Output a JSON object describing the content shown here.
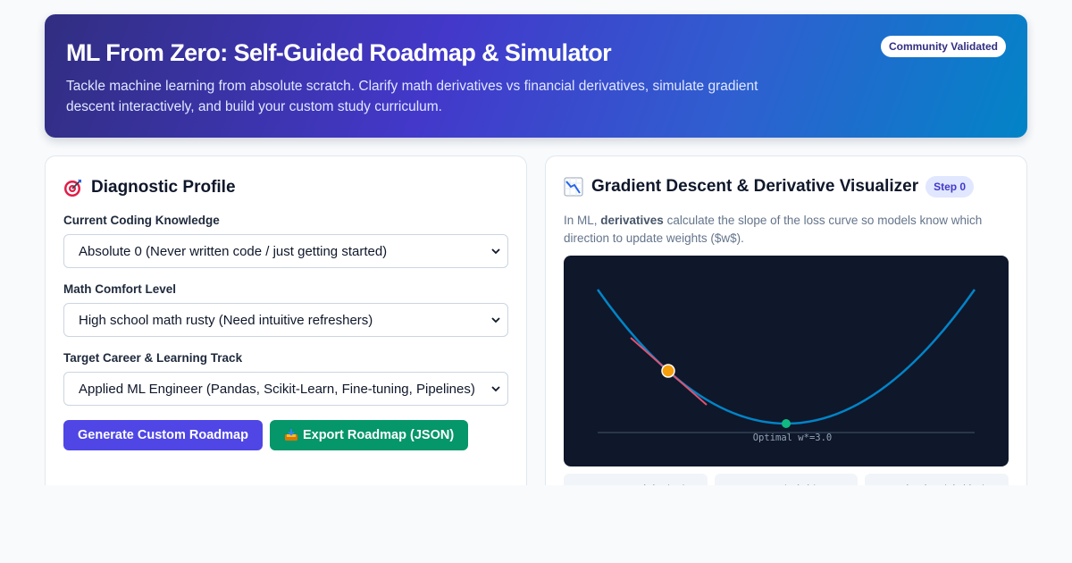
{
  "header": {
    "title": "ML From Zero: Self-Guided Roadmap & Simulator",
    "subtitle": "Tackle machine learning from absolute scratch. Clarify math derivatives vs financial derivatives, simulate gradient descent interactively, and build your custom study curriculum.",
    "badge": "Community Validated"
  },
  "profile": {
    "title": "Diagnostic Profile",
    "icon": "target-icon",
    "coding_label": "Current Coding Knowledge",
    "coding_value": "Absolute 0 (Never written code / just getting started)",
    "math_label": "Math Comfort Level",
    "math_value": "High school math rusty (Need intuitive refreshers)",
    "track_label": "Target Career & Learning Track",
    "track_value": "Applied ML Engineer (Pandas, Scikit-Learn, Fine-tuning, Pipelines)",
    "generate_label": "Generate Custom Roadmap",
    "export_label": "Export Roadmap (JSON)"
  },
  "visualizer": {
    "title": "Gradient Descent & Derivative Visualizer",
    "icon": "chart-decreasing-icon",
    "step_badge": "Step 0",
    "desc_prefix": "In ML, ",
    "desc_bold": "derivatives",
    "desc_suffix": " calculate the slope of the loss curve so models know which direction to update weights ($w$).",
    "optimum_label": "Optimal w*=3.0",
    "metrics": [
      {
        "label": "Current Weight $w$"
      },
      {
        "label": "Loss $L(w)$"
      },
      {
        "label": "Derivative $dL/dw$"
      }
    ]
  },
  "colors": {
    "curve": "#0284c7",
    "current_point": "#f59e0b",
    "optimum_point": "#10b981",
    "tangent": "#e05270",
    "viz_bg": "#0f172a"
  }
}
